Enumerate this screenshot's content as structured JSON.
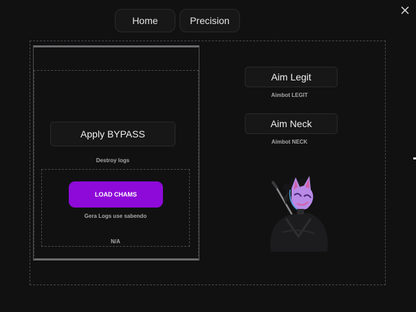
{
  "nav": {
    "tabs": [
      {
        "label": "Home"
      },
      {
        "label": "Precision"
      }
    ]
  },
  "left_panel": {
    "apply_bypass_label": "Apply BYPASS",
    "apply_bypass_caption": "Destroy logs",
    "load_chams_label": "LOAD CHAMS",
    "load_chams_caption": "Gera Logs use sabendo",
    "status_text": "N/A"
  },
  "right_panel": {
    "aim_legit_label": "Aim Legit",
    "aim_legit_caption": "Aimbot LEGIT",
    "aim_neck_label": "Aim Neck",
    "aim_neck_caption": "Aimbot NECK"
  },
  "icons": {
    "close": "close-icon",
    "mascot": "ninja-fox-mask-image"
  },
  "colors": {
    "background": "#111112",
    "accent_purple": "#8e0ad8",
    "button_dark": "#171718",
    "caption_gray": "#a8a8aa"
  }
}
